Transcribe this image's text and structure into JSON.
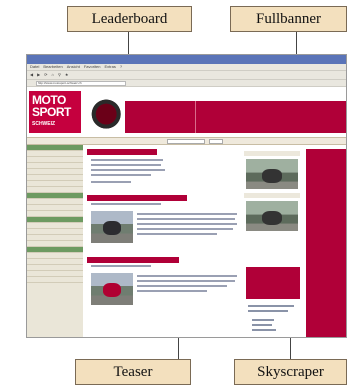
{
  "labels": {
    "leaderboard": "Leaderboard",
    "fullbanner": "Fullbanner",
    "teaser": "Teaser",
    "skyscraper": "Skyscraper"
  },
  "browser": {
    "menu": [
      "Datei",
      "Bearbeiten",
      "Ansicht",
      "Favoriten",
      "Extras",
      "?"
    ],
    "address": "http://www.motosport-schweiz.ch"
  },
  "logo": {
    "line1": "MOTO",
    "line2": "SPORT",
    "line3": "SCHWEIZ"
  },
  "colors": {
    "brand_red": "#b00038",
    "label_bg": "#f3e0be",
    "sidebar_bg": "#eae6d8",
    "sidebar_head": "#6d9a61"
  }
}
